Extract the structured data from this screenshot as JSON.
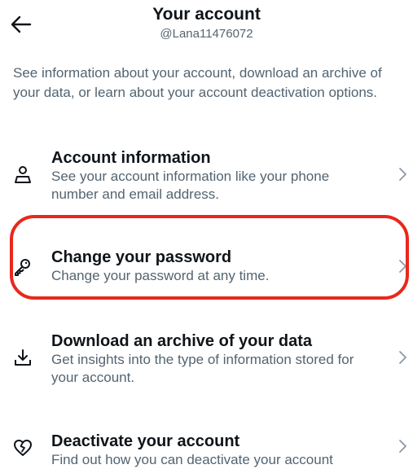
{
  "header": {
    "title": "Your account",
    "username": "@Lana11476072"
  },
  "description": "See information about your account, download an archive of your data, or learn about your account deactivation options.",
  "items": [
    {
      "title": "Account information",
      "description": "See your account information like your phone number and email address.",
      "icon": "person-icon"
    },
    {
      "title": "Change your password",
      "description": "Change your password at any time.",
      "icon": "key-icon"
    },
    {
      "title": "Download an archive of your data",
      "description": "Get insights into the type of information stored for your account.",
      "icon": "download-icon"
    },
    {
      "title": "Deactivate your account",
      "description": "Find out how you can deactivate your account",
      "icon": "broken-heart-icon"
    }
  ],
  "colors": {
    "text_primary": "#0f1419",
    "text_secondary": "#536471",
    "chevron": "#8b98a5",
    "highlight": "#e8281c"
  }
}
